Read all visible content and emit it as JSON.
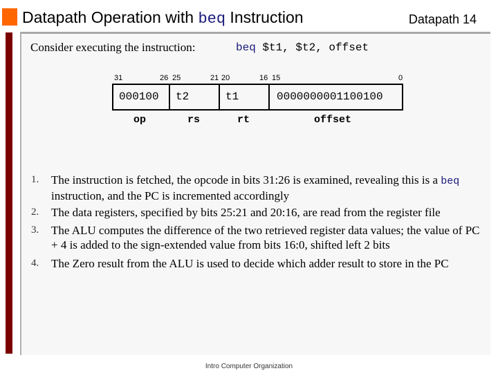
{
  "header": {
    "title_prefix": "Datapath Operation with ",
    "title_code": "beq",
    "title_suffix": " Instruction",
    "slide_label": "Datapath  14",
    "accent_color": "#ff6600",
    "bar_color": "#7a0000"
  },
  "intro": {
    "text": "Consider executing the instruction:",
    "instruction_keyword": "beq",
    "instruction_operands": " $t1, $t2, offset"
  },
  "instruction_format": {
    "bit_numbers": [
      "31",
      "26",
      "25",
      "21",
      "20",
      "16",
      "15",
      "0"
    ],
    "fields": [
      {
        "value": "000100",
        "label": "op"
      },
      {
        "value": "t2",
        "label": "rs"
      },
      {
        "value": "t1",
        "label": "rt"
      },
      {
        "value": "0000000001100100",
        "label": "offset"
      }
    ]
  },
  "steps": [
    {
      "number": "1.",
      "text_before": "The instruction is fetched, the opcode in bits 31:26 is examined, revealing this is a ",
      "code": "beq",
      "text_after": " instruction, and the PC is incremented accordingly"
    },
    {
      "number": "2.",
      "text_before": "The data registers, specified by bits 25:21 and 20:16, are read from the register file",
      "code": "",
      "text_after": ""
    },
    {
      "number": "3.",
      "text_before": "The ALU computes the difference of the two retrieved register data values; the value of PC + 4 is added to the sign-extended value from bits 16:0, shifted left 2 bits",
      "code": "",
      "text_after": ""
    },
    {
      "number": "4.",
      "text_before": "The Zero result from the ALU is used to decide which adder result to store in the PC",
      "code": "",
      "text_after": ""
    }
  ],
  "footer": {
    "text": "Intro Computer Organization"
  }
}
